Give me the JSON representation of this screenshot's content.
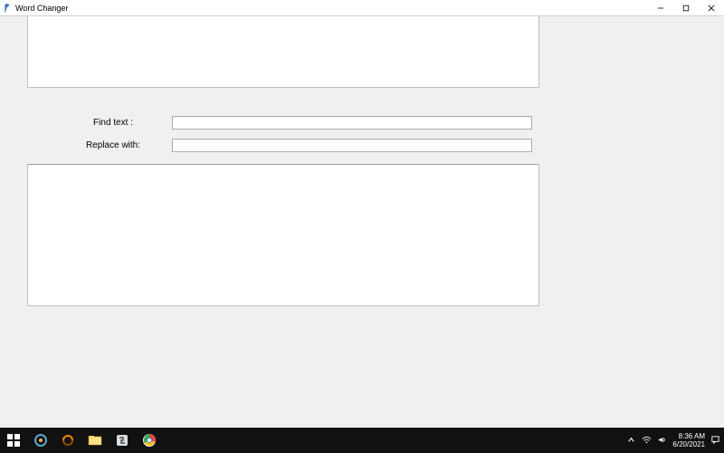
{
  "window": {
    "title": "Word Changer"
  },
  "fields": {
    "find_label": "Find text :",
    "find_value": "",
    "replace_label": "Replace with:",
    "replace_value": ""
  },
  "textareas": {
    "input_text": "",
    "output_text": ""
  },
  "system": {
    "time": "8:36 AM",
    "date": "6/20/2021"
  }
}
